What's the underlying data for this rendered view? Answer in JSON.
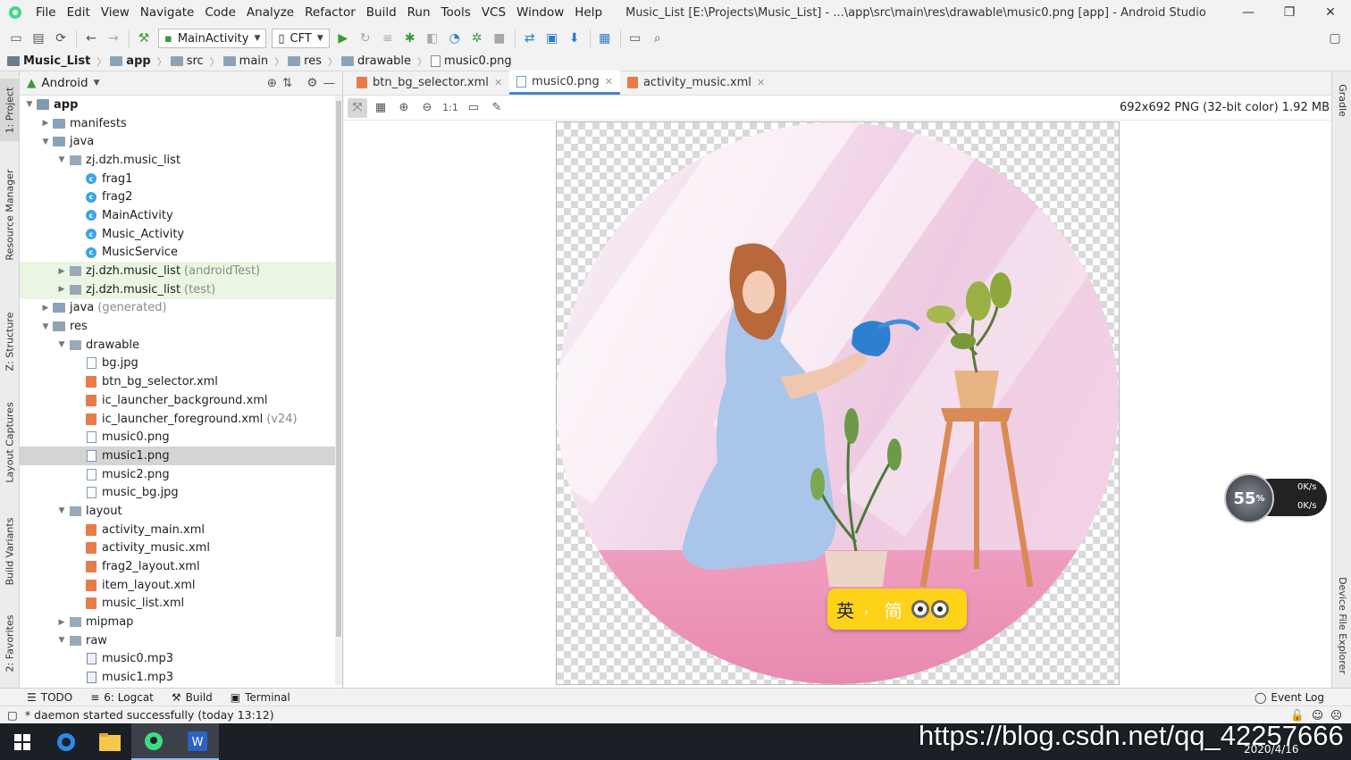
{
  "menubar": {
    "items": [
      "File",
      "Edit",
      "View",
      "Navigate",
      "Code",
      "Analyze",
      "Refactor",
      "Build",
      "Run",
      "Tools",
      "VCS",
      "Window",
      "Help"
    ],
    "title": "Music_List [E:\\Projects\\Music_List] - ...\\app\\src\\main\\res\\drawable\\music0.png [app] - Android Studio"
  },
  "toolbar": {
    "run_config": "MainActivity",
    "device": "CFT"
  },
  "breadcrumb": [
    "Music_List",
    "app",
    "src",
    "main",
    "res",
    "drawable",
    "music0.png"
  ],
  "left_stripe": {
    "project": "1: Project",
    "resource_manager": "Resource Manager",
    "structure": "Z: Structure",
    "layout_captures": "Layout Captures",
    "build_variants": "Build Variants",
    "favorites": "2: Favorites"
  },
  "right_stripe": {
    "gradle": "Gradle",
    "device_file_explorer": "Device File Explorer"
  },
  "project": {
    "view_mode": "Android",
    "tree": [
      {
        "label": "app",
        "depth": 0,
        "icon": "module",
        "open": true,
        "bold": true
      },
      {
        "label": "manifests",
        "depth": 1,
        "icon": "folder",
        "open": false
      },
      {
        "label": "java",
        "depth": 1,
        "icon": "folder",
        "open": true
      },
      {
        "label": "zj.dzh.music_list",
        "depth": 2,
        "icon": "package",
        "open": true
      },
      {
        "label": "frag1",
        "depth": 3,
        "icon": "class"
      },
      {
        "label": "frag2",
        "depth": 3,
        "icon": "class"
      },
      {
        "label": "MainActivity",
        "depth": 3,
        "icon": "class"
      },
      {
        "label": "Music_Activity",
        "depth": 3,
        "icon": "class"
      },
      {
        "label": "MusicService",
        "depth": 3,
        "icon": "class"
      },
      {
        "label": "zj.dzh.music_list",
        "suffix": "(androidTest)",
        "depth": 2,
        "icon": "package",
        "open": false,
        "test": true
      },
      {
        "label": "zj.dzh.music_list",
        "suffix": "(test)",
        "depth": 2,
        "icon": "package",
        "open": false,
        "test": true
      },
      {
        "label": "java",
        "suffix": "(generated)",
        "depth": 1,
        "icon": "folder",
        "open": false
      },
      {
        "label": "res",
        "depth": 1,
        "icon": "res",
        "open": true
      },
      {
        "label": "drawable",
        "depth": 2,
        "icon": "package",
        "open": true
      },
      {
        "label": "bg.jpg",
        "depth": 3,
        "icon": "image"
      },
      {
        "label": "btn_bg_selector.xml",
        "depth": 3,
        "icon": "xml"
      },
      {
        "label": "ic_launcher_background.xml",
        "depth": 3,
        "icon": "xml"
      },
      {
        "label": "ic_launcher_foreground.xml",
        "suffix": "(v24)",
        "depth": 3,
        "icon": "xml"
      },
      {
        "label": "music0.png",
        "depth": 3,
        "icon": "image"
      },
      {
        "label": "music1.png",
        "depth": 3,
        "icon": "image",
        "selected": true
      },
      {
        "label": "music2.png",
        "depth": 3,
        "icon": "image"
      },
      {
        "label": "music_bg.jpg",
        "depth": 3,
        "icon": "image"
      },
      {
        "label": "layout",
        "depth": 2,
        "icon": "package",
        "open": true
      },
      {
        "label": "activity_main.xml",
        "depth": 3,
        "icon": "xml"
      },
      {
        "label": "activity_music.xml",
        "depth": 3,
        "icon": "xml"
      },
      {
        "label": "frag2_layout.xml",
        "depth": 3,
        "icon": "xml"
      },
      {
        "label": "item_layout.xml",
        "depth": 3,
        "icon": "xml"
      },
      {
        "label": "music_list.xml",
        "depth": 3,
        "icon": "xml"
      },
      {
        "label": "mipmap",
        "depth": 2,
        "icon": "package",
        "open": false
      },
      {
        "label": "raw",
        "depth": 2,
        "icon": "package",
        "open": true
      },
      {
        "label": "music0.mp3",
        "depth": 3,
        "icon": "mp3"
      },
      {
        "label": "music1.mp3",
        "depth": 3,
        "icon": "mp3"
      }
    ]
  },
  "editor": {
    "tabs": [
      {
        "label": "btn_bg_selector.xml",
        "active": false
      },
      {
        "label": "music0.png",
        "active": true
      },
      {
        "label": "activity_music.xml",
        "active": false
      }
    ],
    "zoom_actual": "1:1",
    "image_info": "692x692 PNG (32-bit color) 1.92 MB"
  },
  "ime": {
    "lang": "英",
    "sep": "，",
    "mode": "简"
  },
  "netmon": {
    "percent": "55",
    "unit": "%",
    "up": "0K/s",
    "down": "0K/s"
  },
  "bottombar": {
    "todo": "TODO",
    "logcat": "6: Logcat",
    "build": "Build",
    "terminal": "Terminal",
    "event_log": "Event Log"
  },
  "statusbar": {
    "message": "* daemon started successfully (today 13:12)"
  },
  "taskbar": {
    "date": "2020/4/16"
  },
  "watermark": "https://blog.csdn.net/qq_42257666",
  "colors": {
    "accent": "#4a88c7",
    "ime_bg": "#ffd21a",
    "taskbar": "#1b1f26"
  }
}
